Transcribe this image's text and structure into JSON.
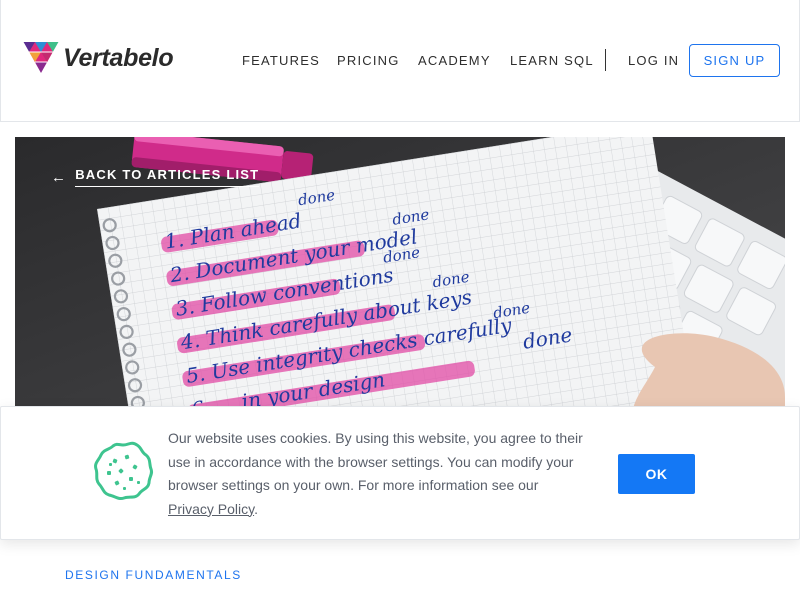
{
  "header": {
    "logo_text": "Vertabelo",
    "nav": [
      "FEATURES",
      "PRICING",
      "ACADEMY",
      "LEARN SQL"
    ],
    "login_label": "LOG IN",
    "signup_label": "SIGN UP"
  },
  "hero": {
    "back_label": "BACK TO ARTICLES LIST",
    "notebook_items": [
      "1. Plan ahead",
      "2. Document your model",
      "3. Follow conventions",
      "4. Think carefully about keys",
      "5. Use integrity checks carefully",
      "6. ... in your design"
    ],
    "done_label": "done"
  },
  "cookie_banner": {
    "text": "Our website uses cookies. By using this website, you agree to their use in accordance with the browser settings. You can modify your browser settings on your own. For more information see our ",
    "link_label": "Privacy Policy",
    "text_end": ".",
    "ok_label": "OK"
  },
  "article": {
    "category": "DESIGN FUNDAMENTALS"
  },
  "colors": {
    "accent": "#1e74ee",
    "ok_button": "#1478f5",
    "cookie_icon": "#3ec48f",
    "highlighter": "#e24ba6"
  }
}
